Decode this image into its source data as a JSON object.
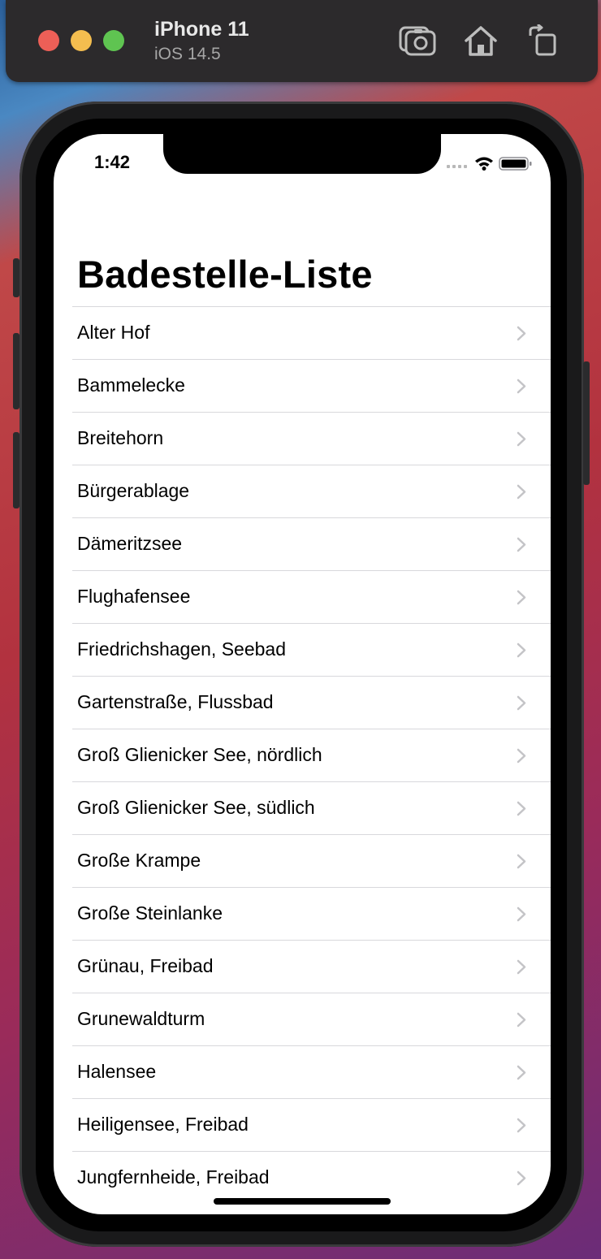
{
  "simulator": {
    "device_name": "iPhone 11",
    "os_version": "iOS 14.5",
    "icons": [
      "screenshot-icon",
      "home-icon",
      "rotate-icon"
    ]
  },
  "status_bar": {
    "time": "1:42",
    "icons": [
      "cellular-icon",
      "wifi-icon",
      "battery-icon"
    ]
  },
  "nav": {
    "title": "Badestelle-Liste"
  },
  "list": {
    "items": [
      {
        "label": "Alter Hof"
      },
      {
        "label": "Bammelecke"
      },
      {
        "label": "Breitehorn"
      },
      {
        "label": "Bürgerablage"
      },
      {
        "label": "Dämeritzsee"
      },
      {
        "label": "Flughafensee"
      },
      {
        "label": "Friedrichshagen, Seebad"
      },
      {
        "label": "Gartenstraße, Flussbad"
      },
      {
        "label": "Groß Glienicker See, nördlich"
      },
      {
        "label": "Groß Glienicker See, südlich"
      },
      {
        "label": "Große Krampe"
      },
      {
        "label": "Große Steinlanke"
      },
      {
        "label": "Grünau, Freibad"
      },
      {
        "label": "Grunewaldturm"
      },
      {
        "label": "Halensee"
      },
      {
        "label": "Heiligensee, Freibad"
      },
      {
        "label": "Jungfernheide, Freibad"
      }
    ]
  },
  "colors": {
    "separator": "#d8d8dc",
    "chevron": "#c4c4c7",
    "sim_bar": "#2c2a2c"
  }
}
